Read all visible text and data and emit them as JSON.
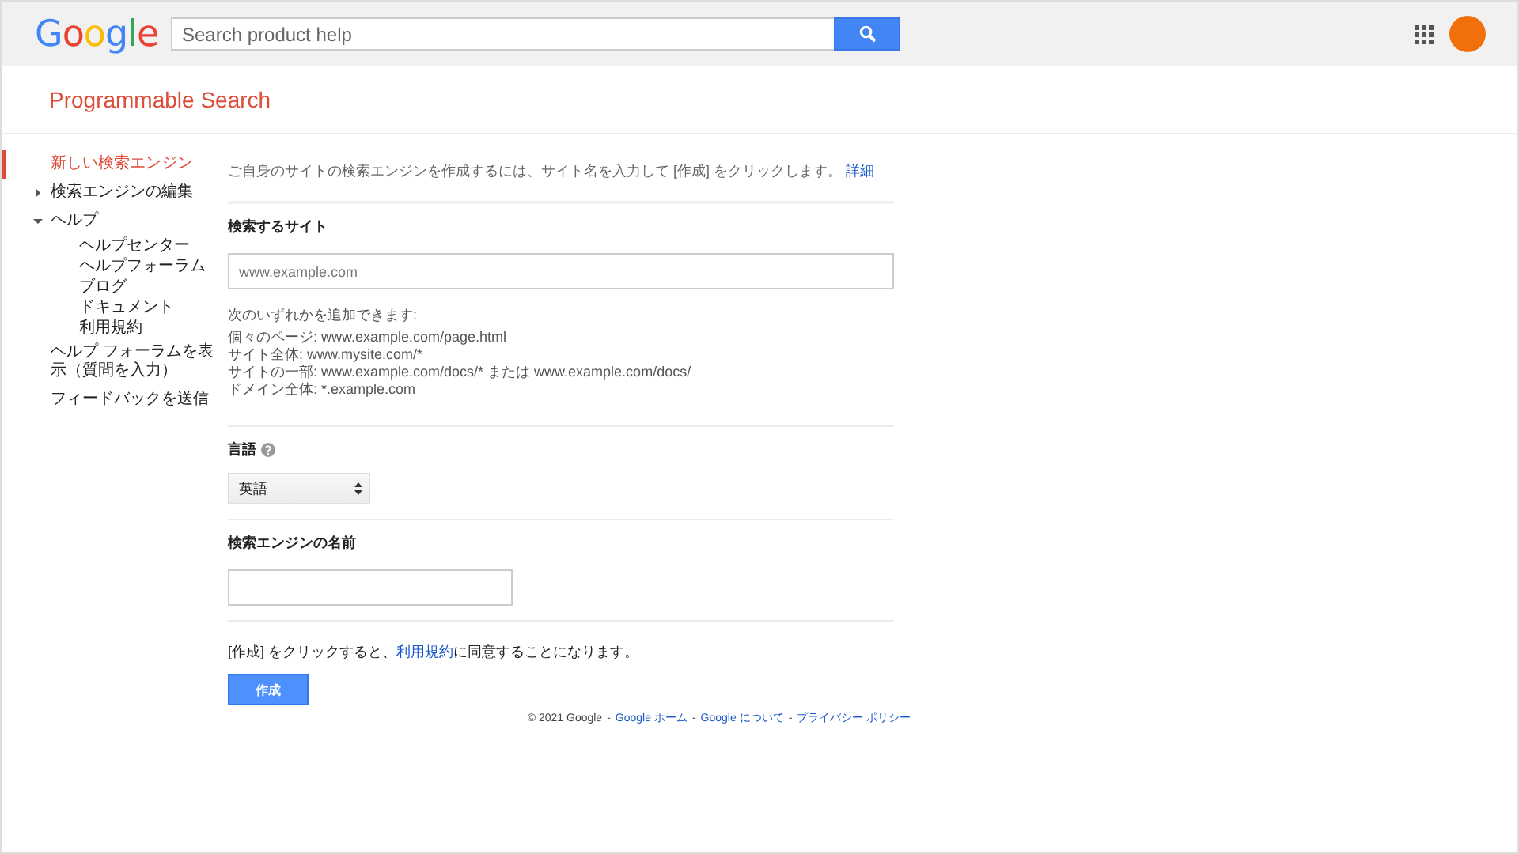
{
  "header": {
    "logo": "Google",
    "search": {
      "placeholder": "Search product help"
    }
  },
  "product_title": "Programmable Search",
  "sidebar": {
    "items": [
      {
        "label": "新しい検索エンジン",
        "selected": true
      },
      {
        "label": "検索エンジンの編集",
        "selected": false,
        "expanded": false
      },
      {
        "label": "ヘルプ",
        "selected": false,
        "expanded": true,
        "children": [
          {
            "label": "ヘルプセンター",
            "selected": false
          },
          {
            "label": "ヘルプフォーラム",
            "selected": false
          },
          {
            "label": "ブログ",
            "selected": false
          },
          {
            "label": "ドキュメント",
            "selected": false
          },
          {
            "label": "利用規約",
            "selected": false
          }
        ]
      },
      {
        "label": "ヘルプ フォーラムを表示（質問を入力）",
        "selected": false
      },
      {
        "label": "フィードバックを送信",
        "selected": false
      }
    ]
  },
  "intro": {
    "text": "ご自身のサイトの検索エンジンを作成するには、サイト名を入力して [作成] をクリックします。",
    "link": "詳細"
  },
  "site_section": {
    "label": "検索するサイト",
    "placeholder": "www.example.com",
    "hint": "次のいずれかを追加できます:",
    "examples": [
      "個々のページ: www.example.com/page.html",
      "サイト全体: www.mysite.com/*",
      "サイトの一部: www.example.com/docs/* または www.example.com/docs/",
      "ドメイン全体: *.example.com"
    ]
  },
  "language_section": {
    "label": "言語",
    "value": "英語"
  },
  "name_section": {
    "label": "検索エンジンの名前"
  },
  "terms": {
    "before": "[作成] をクリックすると、",
    "link": "利用規約",
    "after": "に同意することになります。"
  },
  "create_button": "作成",
  "footer": {
    "copyright": "© 2021 Google",
    "separator": "-",
    "links": [
      "Google ホーム",
      "Google について",
      "プライバシー ポリシー"
    ]
  }
}
